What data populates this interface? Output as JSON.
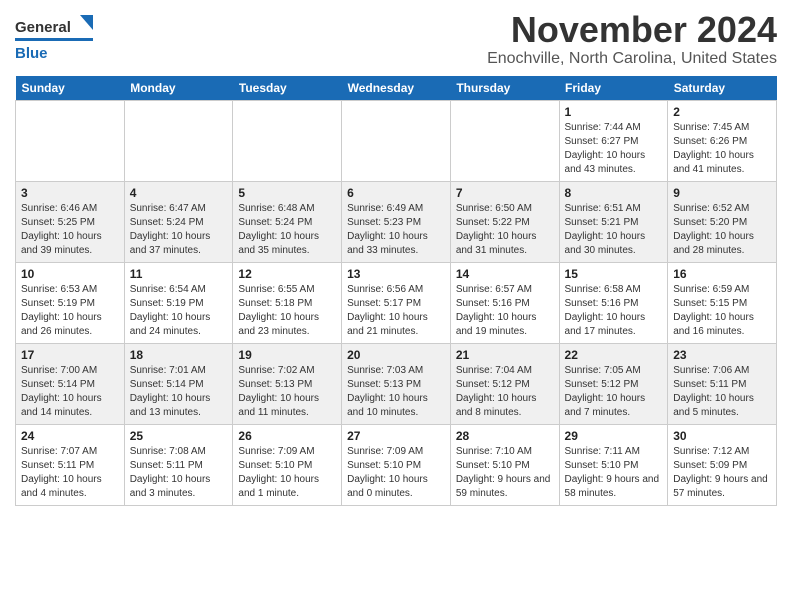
{
  "header": {
    "logo_text_general": "General",
    "logo_text_blue": "Blue",
    "title": "November 2024",
    "subtitle": "Enochville, North Carolina, United States"
  },
  "calendar": {
    "headers": [
      "Sunday",
      "Monday",
      "Tuesday",
      "Wednesday",
      "Thursday",
      "Friday",
      "Saturday"
    ],
    "weeks": [
      [
        {
          "day": "",
          "info": ""
        },
        {
          "day": "",
          "info": ""
        },
        {
          "day": "",
          "info": ""
        },
        {
          "day": "",
          "info": ""
        },
        {
          "day": "",
          "info": ""
        },
        {
          "day": "1",
          "info": "Sunrise: 7:44 AM\nSunset: 6:27 PM\nDaylight: 10 hours and 43 minutes."
        },
        {
          "day": "2",
          "info": "Sunrise: 7:45 AM\nSunset: 6:26 PM\nDaylight: 10 hours and 41 minutes."
        }
      ],
      [
        {
          "day": "3",
          "info": "Sunrise: 6:46 AM\nSunset: 5:25 PM\nDaylight: 10 hours and 39 minutes."
        },
        {
          "day": "4",
          "info": "Sunrise: 6:47 AM\nSunset: 5:24 PM\nDaylight: 10 hours and 37 minutes."
        },
        {
          "day": "5",
          "info": "Sunrise: 6:48 AM\nSunset: 5:24 PM\nDaylight: 10 hours and 35 minutes."
        },
        {
          "day": "6",
          "info": "Sunrise: 6:49 AM\nSunset: 5:23 PM\nDaylight: 10 hours and 33 minutes."
        },
        {
          "day": "7",
          "info": "Sunrise: 6:50 AM\nSunset: 5:22 PM\nDaylight: 10 hours and 31 minutes."
        },
        {
          "day": "8",
          "info": "Sunrise: 6:51 AM\nSunset: 5:21 PM\nDaylight: 10 hours and 30 minutes."
        },
        {
          "day": "9",
          "info": "Sunrise: 6:52 AM\nSunset: 5:20 PM\nDaylight: 10 hours and 28 minutes."
        }
      ],
      [
        {
          "day": "10",
          "info": "Sunrise: 6:53 AM\nSunset: 5:19 PM\nDaylight: 10 hours and 26 minutes."
        },
        {
          "day": "11",
          "info": "Sunrise: 6:54 AM\nSunset: 5:19 PM\nDaylight: 10 hours and 24 minutes."
        },
        {
          "day": "12",
          "info": "Sunrise: 6:55 AM\nSunset: 5:18 PM\nDaylight: 10 hours and 23 minutes."
        },
        {
          "day": "13",
          "info": "Sunrise: 6:56 AM\nSunset: 5:17 PM\nDaylight: 10 hours and 21 minutes."
        },
        {
          "day": "14",
          "info": "Sunrise: 6:57 AM\nSunset: 5:16 PM\nDaylight: 10 hours and 19 minutes."
        },
        {
          "day": "15",
          "info": "Sunrise: 6:58 AM\nSunset: 5:16 PM\nDaylight: 10 hours and 17 minutes."
        },
        {
          "day": "16",
          "info": "Sunrise: 6:59 AM\nSunset: 5:15 PM\nDaylight: 10 hours and 16 minutes."
        }
      ],
      [
        {
          "day": "17",
          "info": "Sunrise: 7:00 AM\nSunset: 5:14 PM\nDaylight: 10 hours and 14 minutes."
        },
        {
          "day": "18",
          "info": "Sunrise: 7:01 AM\nSunset: 5:14 PM\nDaylight: 10 hours and 13 minutes."
        },
        {
          "day": "19",
          "info": "Sunrise: 7:02 AM\nSunset: 5:13 PM\nDaylight: 10 hours and 11 minutes."
        },
        {
          "day": "20",
          "info": "Sunrise: 7:03 AM\nSunset: 5:13 PM\nDaylight: 10 hours and 10 minutes."
        },
        {
          "day": "21",
          "info": "Sunrise: 7:04 AM\nSunset: 5:12 PM\nDaylight: 10 hours and 8 minutes."
        },
        {
          "day": "22",
          "info": "Sunrise: 7:05 AM\nSunset: 5:12 PM\nDaylight: 10 hours and 7 minutes."
        },
        {
          "day": "23",
          "info": "Sunrise: 7:06 AM\nSunset: 5:11 PM\nDaylight: 10 hours and 5 minutes."
        }
      ],
      [
        {
          "day": "24",
          "info": "Sunrise: 7:07 AM\nSunset: 5:11 PM\nDaylight: 10 hours and 4 minutes."
        },
        {
          "day": "25",
          "info": "Sunrise: 7:08 AM\nSunset: 5:11 PM\nDaylight: 10 hours and 3 minutes."
        },
        {
          "day": "26",
          "info": "Sunrise: 7:09 AM\nSunset: 5:10 PM\nDaylight: 10 hours and 1 minute."
        },
        {
          "day": "27",
          "info": "Sunrise: 7:09 AM\nSunset: 5:10 PM\nDaylight: 10 hours and 0 minutes."
        },
        {
          "day": "28",
          "info": "Sunrise: 7:10 AM\nSunset: 5:10 PM\nDaylight: 9 hours and 59 minutes."
        },
        {
          "day": "29",
          "info": "Sunrise: 7:11 AM\nSunset: 5:10 PM\nDaylight: 9 hours and 58 minutes."
        },
        {
          "day": "30",
          "info": "Sunrise: 7:12 AM\nSunset: 5:09 PM\nDaylight: 9 hours and 57 minutes."
        }
      ]
    ]
  }
}
